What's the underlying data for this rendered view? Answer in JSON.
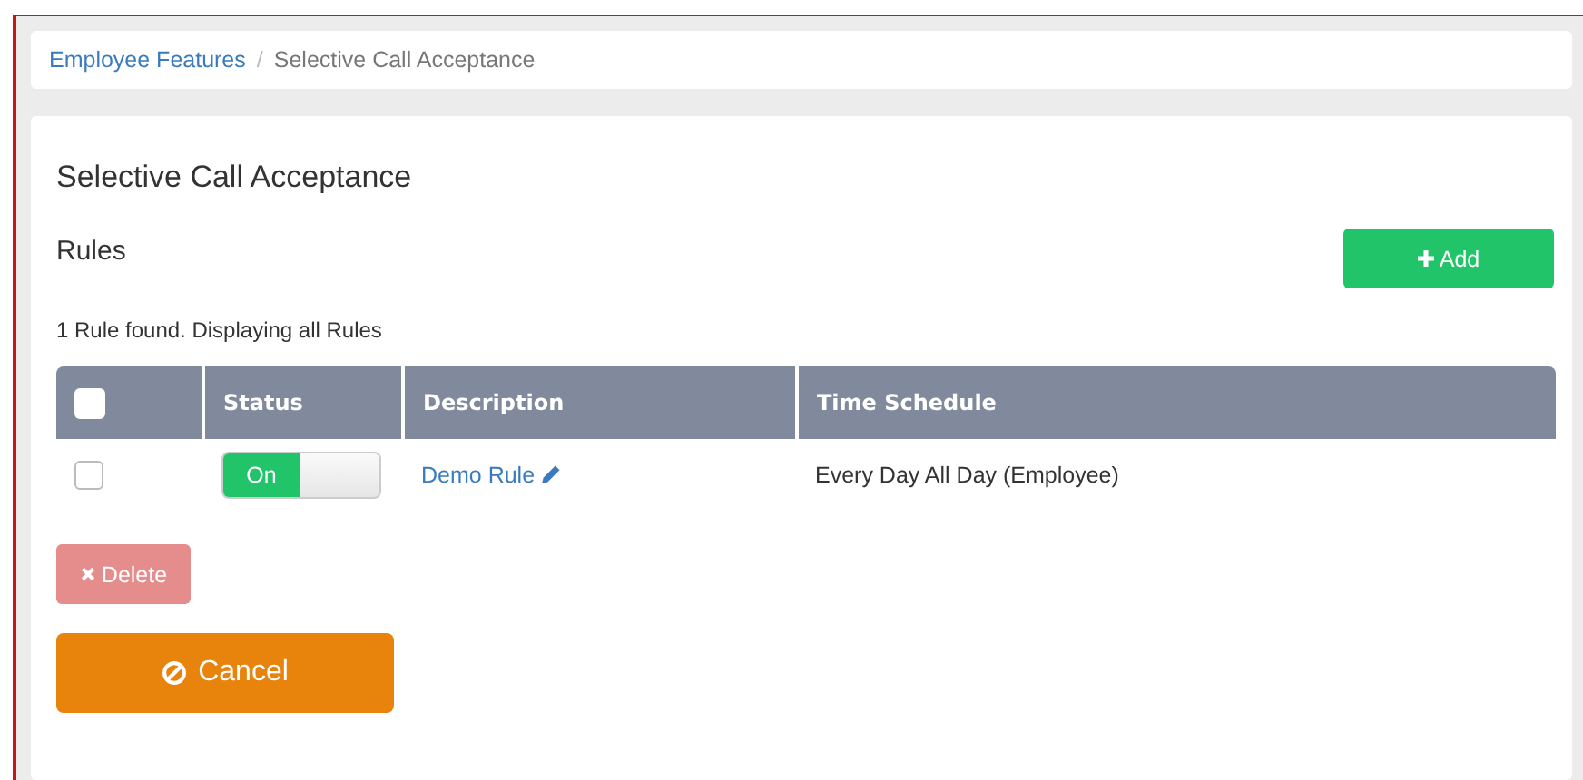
{
  "breadcrumb": [
    {
      "label": "Employee Features",
      "link": true
    },
    {
      "label": "Selective Call Acceptance",
      "link": false
    }
  ],
  "separator": "/",
  "title": "Selective Call Acceptance",
  "section": "Rules",
  "add_button": {
    "label": "Add"
  },
  "summary": "1 Rule found. Displaying all Rules",
  "table": {
    "select_all": {
      "checked": false
    },
    "columns": [
      "Status",
      "Description",
      "Time Schedule"
    ],
    "rows": [
      {
        "checked": false,
        "status": {
          "on": true,
          "label": "On"
        },
        "description": "Demo Rule",
        "time_schedule": "Every Day All Day (Employee)"
      }
    ]
  },
  "delete_button": {
    "label": "Delete",
    "disabled": true
  },
  "cancel_button": {
    "label": "Cancel"
  }
}
